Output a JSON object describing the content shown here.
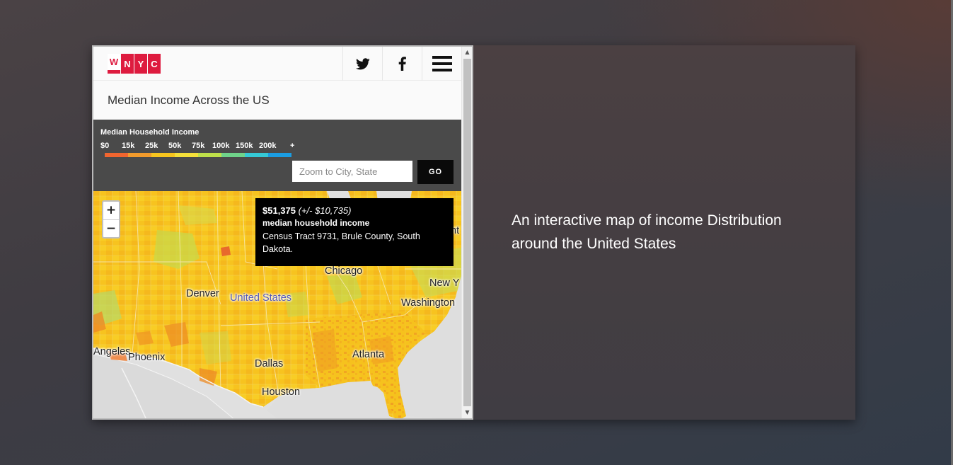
{
  "header": {
    "logo_letters": [
      "W",
      "N",
      "Y",
      "C"
    ],
    "icons": [
      "twitter-icon",
      "facebook-icon",
      "menu-icon"
    ]
  },
  "title": "Median Income Across the US",
  "legend": {
    "title": "Median Household Income",
    "ticks": [
      "$0",
      "15k",
      "25k",
      "50k",
      "75k",
      "100k",
      "150k",
      "200k",
      "+"
    ],
    "colors": [
      "#f0652f",
      "#f29b2c",
      "#f7c51e",
      "#f5e03a",
      "#bfe04a",
      "#6fd38a",
      "#35c9d6",
      "#1b9de2"
    ]
  },
  "search": {
    "placeholder": "Zoom to City, State",
    "go_label": "GO"
  },
  "map": {
    "zoom_in": "+",
    "zoom_out": "−",
    "tooltip": {
      "value": "$51,375",
      "moe": "(+/- $10,735)",
      "label": "median household income",
      "location": "Census Tract 9731, Brule County, South Dakota."
    },
    "places": {
      "chicago": "Chicago",
      "denver": "Denver",
      "united_states": "United States",
      "new_york": "New Y",
      "washington": "Washington",
      "los_angeles": "Angeles",
      "phoenix": "Phoenix",
      "atlanta": "Atlanta",
      "dallas": "Dallas",
      "houston": "Houston",
      "partial_right": "nt"
    }
  },
  "caption": "An interactive map of income Distribution around the United States"
}
